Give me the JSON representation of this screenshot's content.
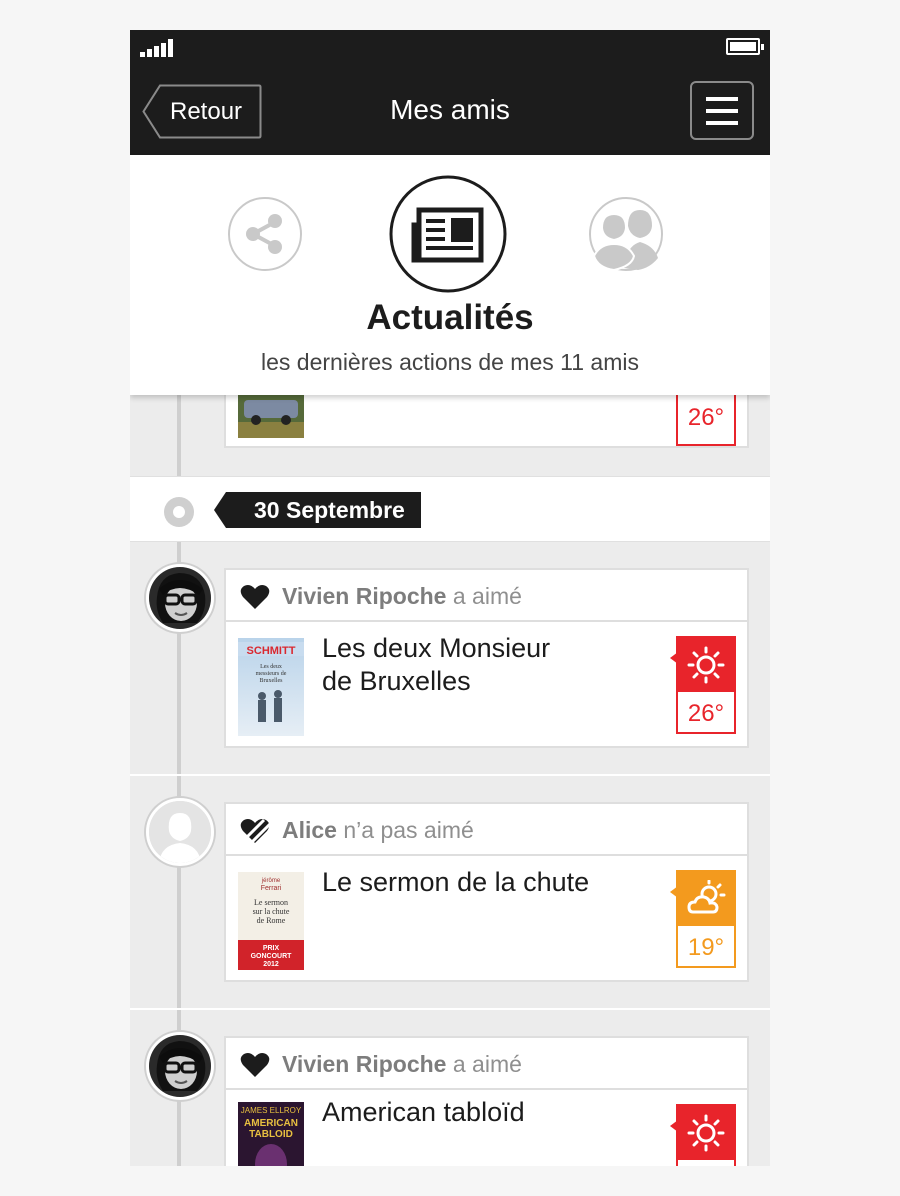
{
  "navbar": {
    "back_label": "Retour",
    "title": "Mes amis"
  },
  "header": {
    "tabs": [
      {
        "icon": "share-icon",
        "active": false
      },
      {
        "icon": "newspaper-icon",
        "active": true
      },
      {
        "icon": "friends-icon",
        "active": false
      }
    ],
    "title": "Actualités",
    "subtitle": "les dernières actions de mes 11 amis"
  },
  "previous_item": {
    "temperature": "26°",
    "weather_color": "#e8242b"
  },
  "date_label": "30 Septembre",
  "feed": [
    {
      "user": "Vivien Ripoche",
      "action": "a aimé",
      "action_icon": "heart-icon",
      "book": "Les deux Monsieur de Bruxelles",
      "book_line1": "Les deux Monsieur",
      "book_line2": "de Bruxelles",
      "weather_icon": "sun-icon",
      "temperature": "26°",
      "weather_color": "#e8242b",
      "cover_text": {
        "top": "SCHMITT",
        "title": "Les deux messieurs de Bruxelles"
      }
    },
    {
      "user": "Alice",
      "action": "n’a pas aimé",
      "action_icon": "broken-heart-icon",
      "book": "Le sermon de la chute",
      "book_line1": "Le sermon de la chute",
      "book_line2": "",
      "weather_icon": "partly-cloudy-icon",
      "temperature": "19°",
      "weather_color": "#f39a1e",
      "cover_text": {
        "top": "Jérôme Ferrari",
        "title": "Le sermon sur la chute de Rome",
        "band": "PRIX GONCOURT 2012"
      }
    },
    {
      "user": "Vivien Ripoche",
      "action": "a aimé",
      "action_icon": "heart-icon",
      "book": "American tabloïd",
      "book_line1": "American tabloïd",
      "book_line2": "",
      "weather_icon": "sun-icon",
      "temperature": "",
      "weather_color": "#e8242b",
      "cover_text": {
        "top": "JAMES ELLROY",
        "title": "AMERICAN TABLOID"
      }
    }
  ]
}
